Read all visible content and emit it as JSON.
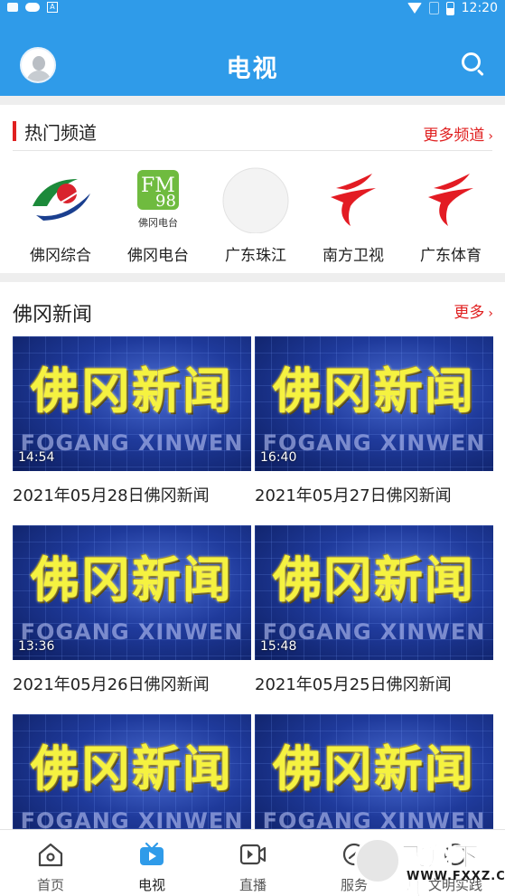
{
  "status_bar": {
    "time": "12:20"
  },
  "header": {
    "title": "电视"
  },
  "hot_channels": {
    "title": "热门频道",
    "more_label": "更多频道",
    "items": [
      {
        "name": "佛冈综合",
        "icon": "fogang-general-logo"
      },
      {
        "name": "佛冈电台",
        "icon": "fogang-radio-logo",
        "logo_text": "佛冈电台",
        "logo_digits": "98",
        "logo_letters": "FM"
      },
      {
        "name": "广东珠江",
        "icon": "blank-logo"
      },
      {
        "name": "南方卫视",
        "icon": "gdtv-logo"
      },
      {
        "name": "广东体育",
        "icon": "gdtv-logo"
      }
    ]
  },
  "news": {
    "title": "佛冈新闻",
    "more_label": "更多",
    "thumb_title": "佛冈新闻",
    "thumb_subtitle": "FOGANG XINWEN",
    "videos": [
      {
        "duration": "14:54",
        "title": "2021年05月28日佛冈新闻"
      },
      {
        "duration": "16:40",
        "title": "2021年05月27日佛冈新闻"
      },
      {
        "duration": "13:36",
        "title": "2021年05月26日佛冈新闻"
      },
      {
        "duration": "15:48",
        "title": "2021年05月25日佛冈新闻"
      },
      {
        "duration": "",
        "title": ""
      },
      {
        "duration": "",
        "title": ""
      }
    ]
  },
  "tabs": [
    {
      "label": "首页",
      "icon": "home-icon"
    },
    {
      "label": "电视",
      "icon": "tv-icon",
      "active": true
    },
    {
      "label": "直播",
      "icon": "live-icon"
    },
    {
      "label": "服务",
      "icon": "service-icon"
    },
    {
      "label": "文明实践",
      "icon": "practice-icon"
    }
  ],
  "watermark": {
    "text": "飞翔下载",
    "url": "WWW.FXXZ.COM"
  },
  "colors": {
    "brand_blue": "#2f9be9",
    "accent_red": "#e02020",
    "tab_active": "#2f9be9"
  }
}
